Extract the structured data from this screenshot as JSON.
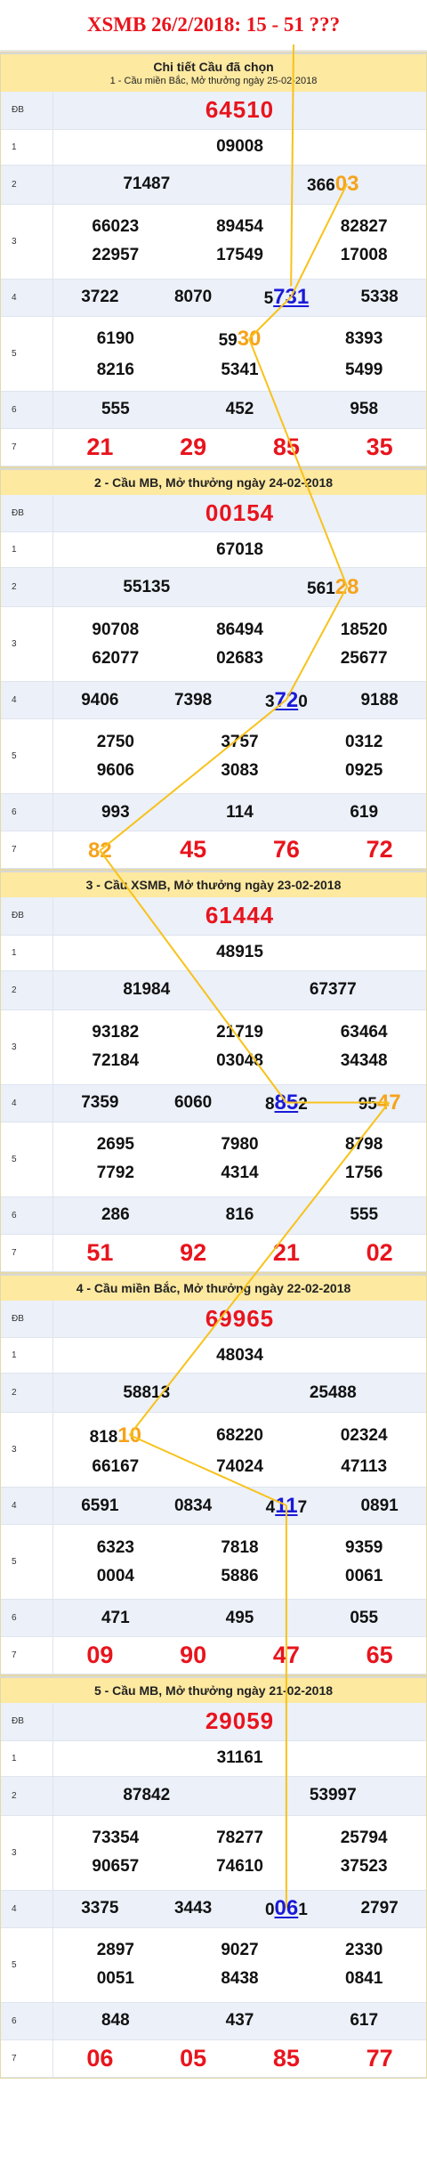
{
  "title": "XSMB 26/2/2018: 15 - 51 ???",
  "boards": [
    {
      "heading": "Chi tiết Cầu đã chọn",
      "subheading": "1 - Cầu miền Bắc, Mở thưởng ngày 25-02-2018",
      "labels": [
        "ĐB",
        "1",
        "2",
        "3",
        "4",
        "5",
        "6",
        "7"
      ],
      "db": "64510",
      "g1": "09008",
      "g2": [
        "71487",
        "366|03|o"
      ],
      "g3": [
        "66023",
        "89454",
        "82827",
        "22957",
        "17549",
        "17008"
      ],
      "g4": [
        "3722",
        "8070",
        "5|731|b",
        "5338"
      ],
      "g5": [
        "6190",
        "59|30|o",
        "8393",
        "8216",
        "5341",
        "5499"
      ],
      "g6": [
        "555",
        "452",
        "958"
      ],
      "g7": [
        "21",
        "29",
        "85",
        "35"
      ]
    },
    {
      "heading": "2 - Cầu MB, Mở thưởng ngày 24-02-2018",
      "subheading": "",
      "labels": [
        "ĐB",
        "1",
        "2",
        "3",
        "4",
        "5",
        "6",
        "7"
      ],
      "db": "00154",
      "g1": "67018",
      "g2": [
        "55135",
        "561|28|o"
      ],
      "g3": [
        "90708",
        "86494",
        "18520",
        "62077",
        "02683",
        "25677"
      ],
      "g4": [
        "9406",
        "7398",
        "3|72|b0",
        "9188"
      ],
      "g5": [
        "2750",
        "3757",
        "0312",
        "9606",
        "3083",
        "0925"
      ],
      "g6": [
        "993",
        "114",
        "619"
      ],
      "g7": [
        "|82|o",
        "45",
        "76",
        "72"
      ]
    },
    {
      "heading": "3 - Cầu XSMB, Mở thưởng ngày 23-02-2018",
      "subheading": "",
      "labels": [
        "ĐB",
        "1",
        "2",
        "3",
        "4",
        "5",
        "6",
        "7"
      ],
      "db": "61444",
      "g1": "48915",
      "g2": [
        "81984",
        "67377"
      ],
      "g3": [
        "93182",
        "21719",
        "63464",
        "72184",
        "03048",
        "34348"
      ],
      "g4": [
        "7359",
        "6060",
        "8|85|b2",
        "95|47|o"
      ],
      "g5": [
        "2695",
        "7980",
        "8798",
        "7792",
        "4314",
        "1756"
      ],
      "g6": [
        "286",
        "816",
        "555"
      ],
      "g7": [
        "51",
        "92",
        "21",
        "02"
      ]
    },
    {
      "heading": "4 - Cầu miền Bắc, Mở thưởng ngày 22-02-2018",
      "subheading": "",
      "labels": [
        "ĐB",
        "1",
        "2",
        "3",
        "4",
        "5",
        "6",
        "7"
      ],
      "db": "69965",
      "g1": "48034",
      "g2": [
        "58813",
        "25488"
      ],
      "g3": [
        "818|10|o",
        "68220",
        "02324",
        "66167",
        "74024",
        "47113"
      ],
      "g4": [
        "6591",
        "0834",
        "4|11|b7",
        "0891"
      ],
      "g5": [
        "6323",
        "7818",
        "9359",
        "0004",
        "5886",
        "0061"
      ],
      "g6": [
        "471",
        "495",
        "055"
      ],
      "g7": [
        "09",
        "90",
        "47",
        "65"
      ]
    },
    {
      "heading": "5 - Cầu MB, Mở thưởng ngày 21-02-2018",
      "subheading": "",
      "labels": [
        "ĐB",
        "1",
        "2",
        "3",
        "4",
        "5",
        "6",
        "7"
      ],
      "db": "29059",
      "g1": "31161",
      "g2": [
        "87842",
        "53997"
      ],
      "g3": [
        "73354",
        "78277",
        "25794",
        "90657",
        "74610",
        "37523"
      ],
      "g4": [
        "3375",
        "3443",
        "0|06|b1",
        "2797"
      ],
      "g5": [
        "2897",
        "9027",
        "2330",
        "0051",
        "8438",
        "0841"
      ],
      "g6": [
        "848",
        "437",
        "617"
      ],
      "g7": [
        "06",
        "05",
        "85",
        "77"
      ]
    }
  ],
  "colors": {
    "title": "#e8141d",
    "header_bg": "#fde9a0",
    "orange": "#f6a31b",
    "blue": "#1a1ad6",
    "arrow": "#f8c21a"
  }
}
